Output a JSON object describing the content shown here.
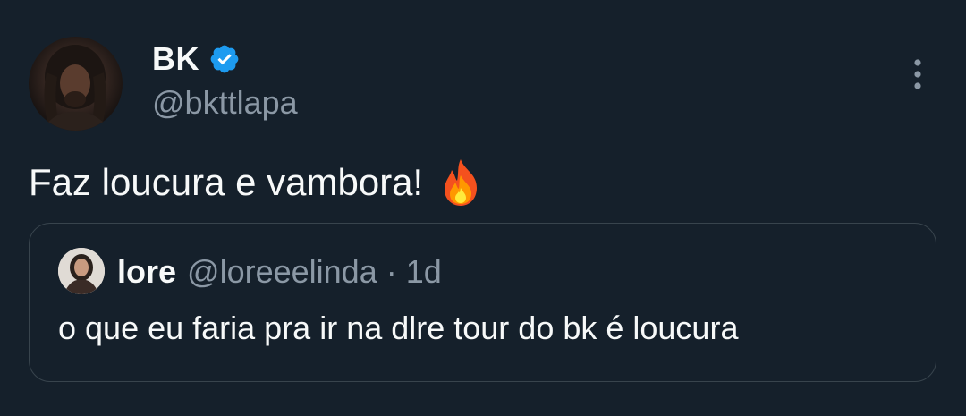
{
  "tweet": {
    "author": {
      "display_name": "BK",
      "handle": "@bkttlapa",
      "verified": true
    },
    "text": "Faz loucura e vambora!",
    "emoji": "fire-emoji",
    "icons": {
      "verified": "verified-badge-icon",
      "more": "more-options-icon"
    },
    "colors": {
      "background": "#15202b",
      "text": "#f7f9f9",
      "secondary_text": "#8b98a5",
      "verified_blue": "#1d9bf0",
      "border": "#38444d"
    }
  },
  "quoted_tweet": {
    "author": {
      "display_name": "lore",
      "handle": "@loreeelinda"
    },
    "separator": "·",
    "time": "1d",
    "text": "o que eu faria pra ir na dlre tour do bk é loucura"
  }
}
